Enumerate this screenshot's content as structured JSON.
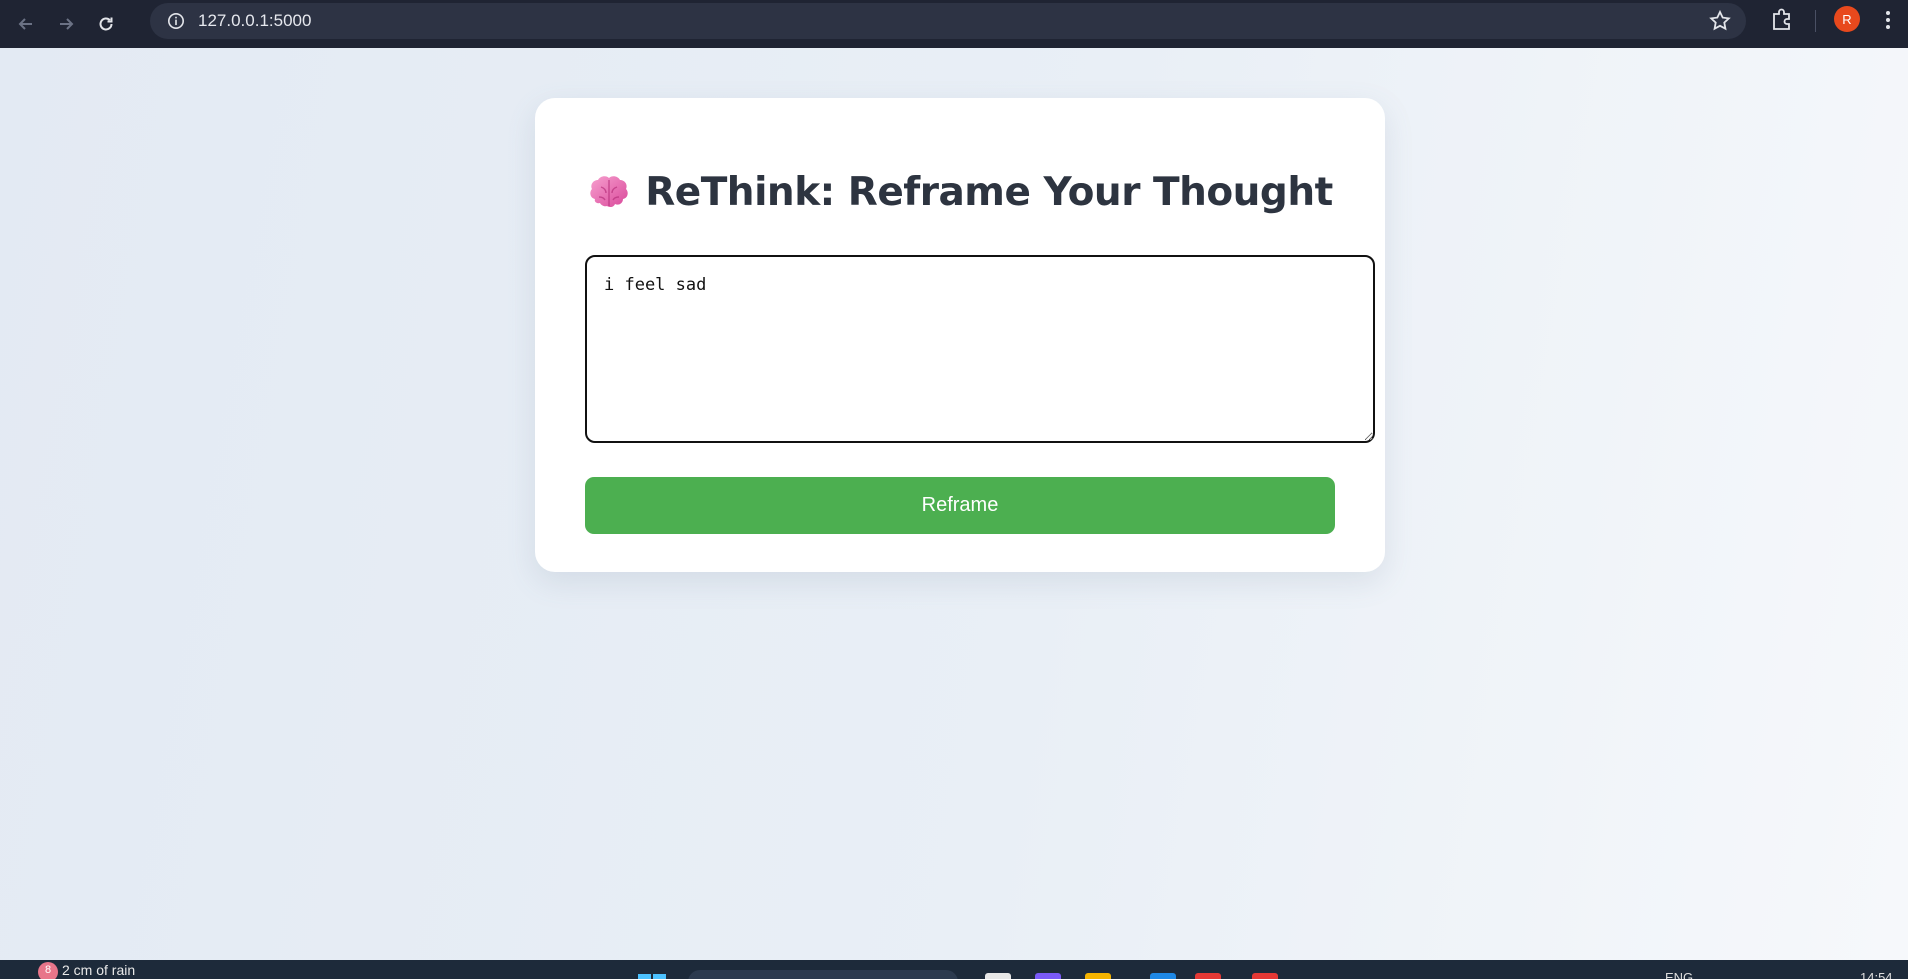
{
  "browser": {
    "url": "127.0.0.1:5000",
    "profile_initial": "R"
  },
  "app": {
    "title": "ReThink: Reframe Your Thought",
    "title_icon": "brain-emoji",
    "thought_value": "i feel sad ",
    "reframe_label": "Reframe",
    "accent_color": "#4caf50"
  },
  "taskbar": {
    "weather_badge": "8",
    "weather_text": "2 cm of rain",
    "language": "ENG",
    "time": "14:54"
  }
}
